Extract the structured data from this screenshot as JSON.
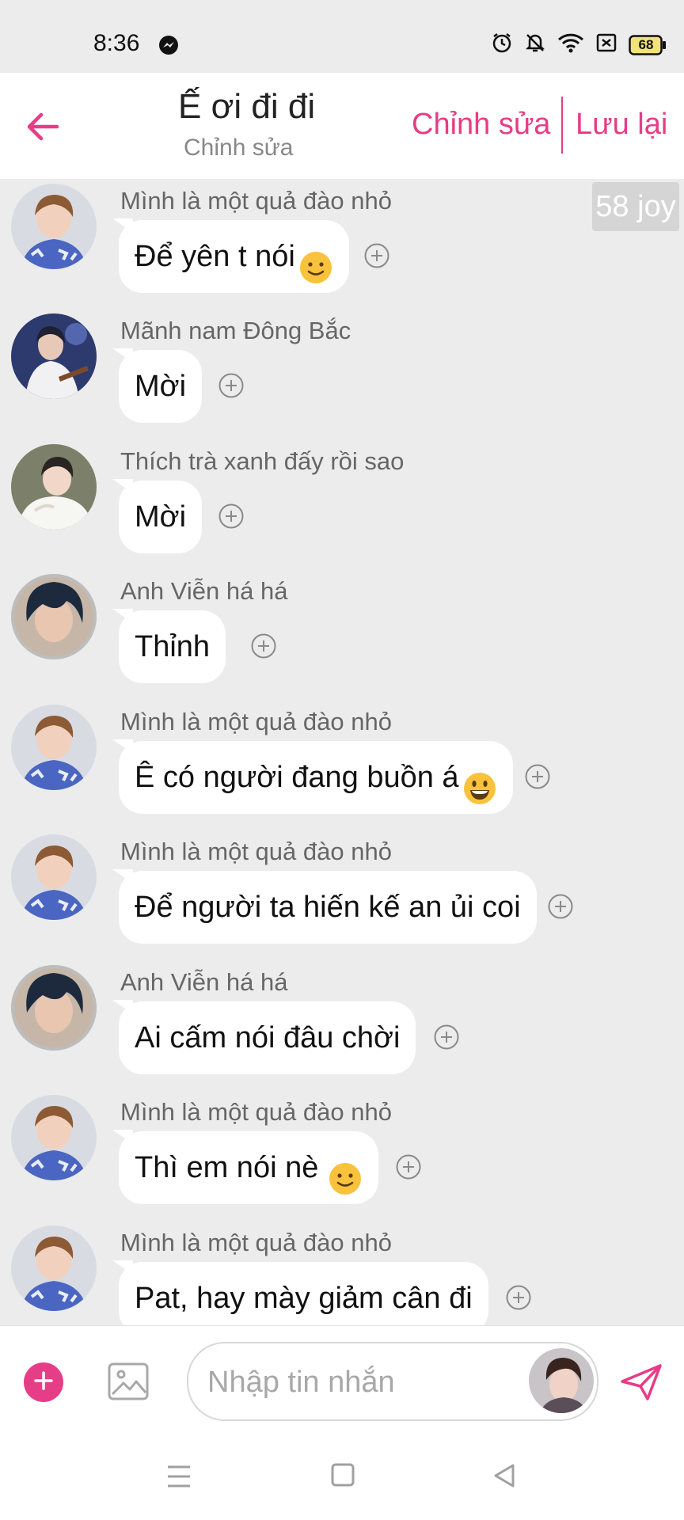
{
  "status": {
    "time": "8:36",
    "battery": "68"
  },
  "header": {
    "title": "Ế ơi đi đi",
    "subtitle": "Chỉnh sửa",
    "edit_label": "Chỉnh sửa",
    "save_label": "Lưu lại"
  },
  "badge": "58 joy",
  "messages": [
    {
      "sender": "Mình là một quả đào nhỏ",
      "text": "Để yên t nói",
      "emoji": "slight-smile"
    },
    {
      "sender": "Mãnh nam Đông Bắc",
      "text": "Mời",
      "emoji": ""
    },
    {
      "sender": "Thích trà xanh đấy rồi sao",
      "text": "Mời",
      "emoji": ""
    },
    {
      "sender": "Anh Viễn há há",
      "text": "Thỉnh",
      "emoji": ""
    },
    {
      "sender": "Mình là một quả đào nhỏ",
      "text": "Ê có người đang buồn á",
      "emoji": "grin"
    },
    {
      "sender": "Mình là một quả đào nhỏ",
      "text": "Để người ta hiến kế an ủi coi",
      "emoji": ""
    },
    {
      "sender": "Anh Viễn há há",
      "text": "Ai cấm nói đâu chời",
      "emoji": ""
    },
    {
      "sender": "Mình là một quả đào nhỏ",
      "text": "Thì em nói nè",
      "emoji": "slight-smile"
    },
    {
      "sender": "Mình là một quả đào nhỏ",
      "text": "Pat, hay mày giảm cân đi",
      "emoji": ""
    }
  ],
  "input": {
    "placeholder": "Nhập tin nhắn"
  },
  "colors": {
    "accent": "#e63d86",
    "background": "#ececec",
    "bubble": "#ffffff"
  },
  "icons": {
    "back": "arrow-left-icon",
    "react": "add-reaction-icon",
    "plus": "plus-icon",
    "image": "image-icon",
    "send": "send-icon"
  }
}
